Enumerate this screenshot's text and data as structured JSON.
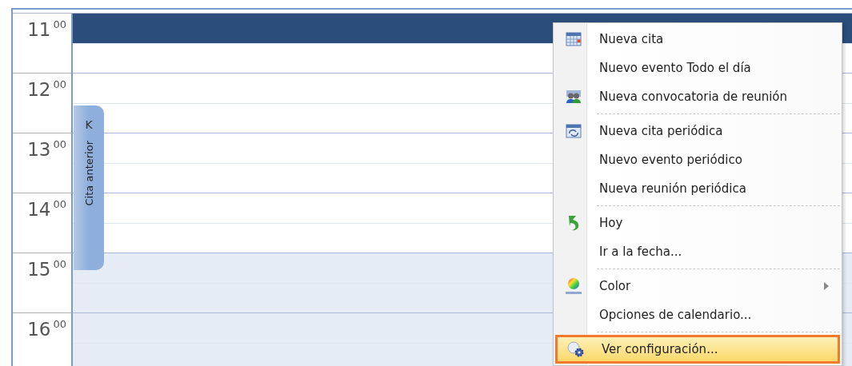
{
  "calendar": {
    "hours": [
      {
        "label": "11$^{00}$",
        "shaded": false,
        "slots": [
          {
            "selected": true
          },
          {
            "selected": false
          }
        ]
      },
      {
        "label": "12$^{00}$",
        "shaded": false,
        "slots": [
          {
            "selected": false
          },
          {
            "selected": false
          }
        ]
      },
      {
        "label": "13$^{00}$",
        "shaded": false,
        "slots": [
          {
            "selected": false
          },
          {
            "selected": false
          }
        ]
      },
      {
        "label": "14$^{00}$",
        "shaded": false,
        "slots": [
          {
            "selected": false
          },
          {
            "selected": false
          }
        ]
      },
      {
        "label": "15$^{00}$",
        "shaded": true,
        "slots": [
          {
            "selected": false
          },
          {
            "selected": false
          }
        ]
      },
      {
        "label": "16$^{00}$",
        "shaded": true,
        "slots": [
          {
            "selected": false
          },
          {
            "selected": false
          }
        ]
      }
    ],
    "previous_tab": {
      "label": "Cita anterior",
      "arrow": "K"
    }
  },
  "context_menu": {
    "items": [
      {
        "kind": "calendar",
        "label": "Nueva cita",
        "submenu": false,
        "selected": false
      },
      {
        "kind": "plain",
        "label": "Nuevo evento Todo el día",
        "submenu": false,
        "selected": false
      },
      {
        "kind": "meeting",
        "label": "Nueva convocatoria de reunión",
        "submenu": false,
        "selected": false
      },
      {
        "kind": "separator"
      },
      {
        "kind": "recurring",
        "label": "Nueva cita periódica",
        "submenu": false,
        "selected": false
      },
      {
        "kind": "plain",
        "label": "Nuevo evento periódico",
        "submenu": false,
        "selected": false
      },
      {
        "kind": "plain",
        "label": "Nueva reunión periódica",
        "submenu": false,
        "selected": false
      },
      {
        "kind": "separator"
      },
      {
        "kind": "today",
        "label": "Hoy",
        "submenu": false,
        "selected": false
      },
      {
        "kind": "plain",
        "label": "Ir a la fecha...",
        "submenu": false,
        "selected": false
      },
      {
        "kind": "separator"
      },
      {
        "kind": "color",
        "label": "Color",
        "submenu": true,
        "selected": false
      },
      {
        "kind": "plain",
        "label": "Opciones de calendario...",
        "submenu": false,
        "selected": false
      },
      {
        "kind": "separator"
      },
      {
        "kind": "settings",
        "label": "Ver configuración...",
        "submenu": false,
        "selected": true
      }
    ]
  }
}
